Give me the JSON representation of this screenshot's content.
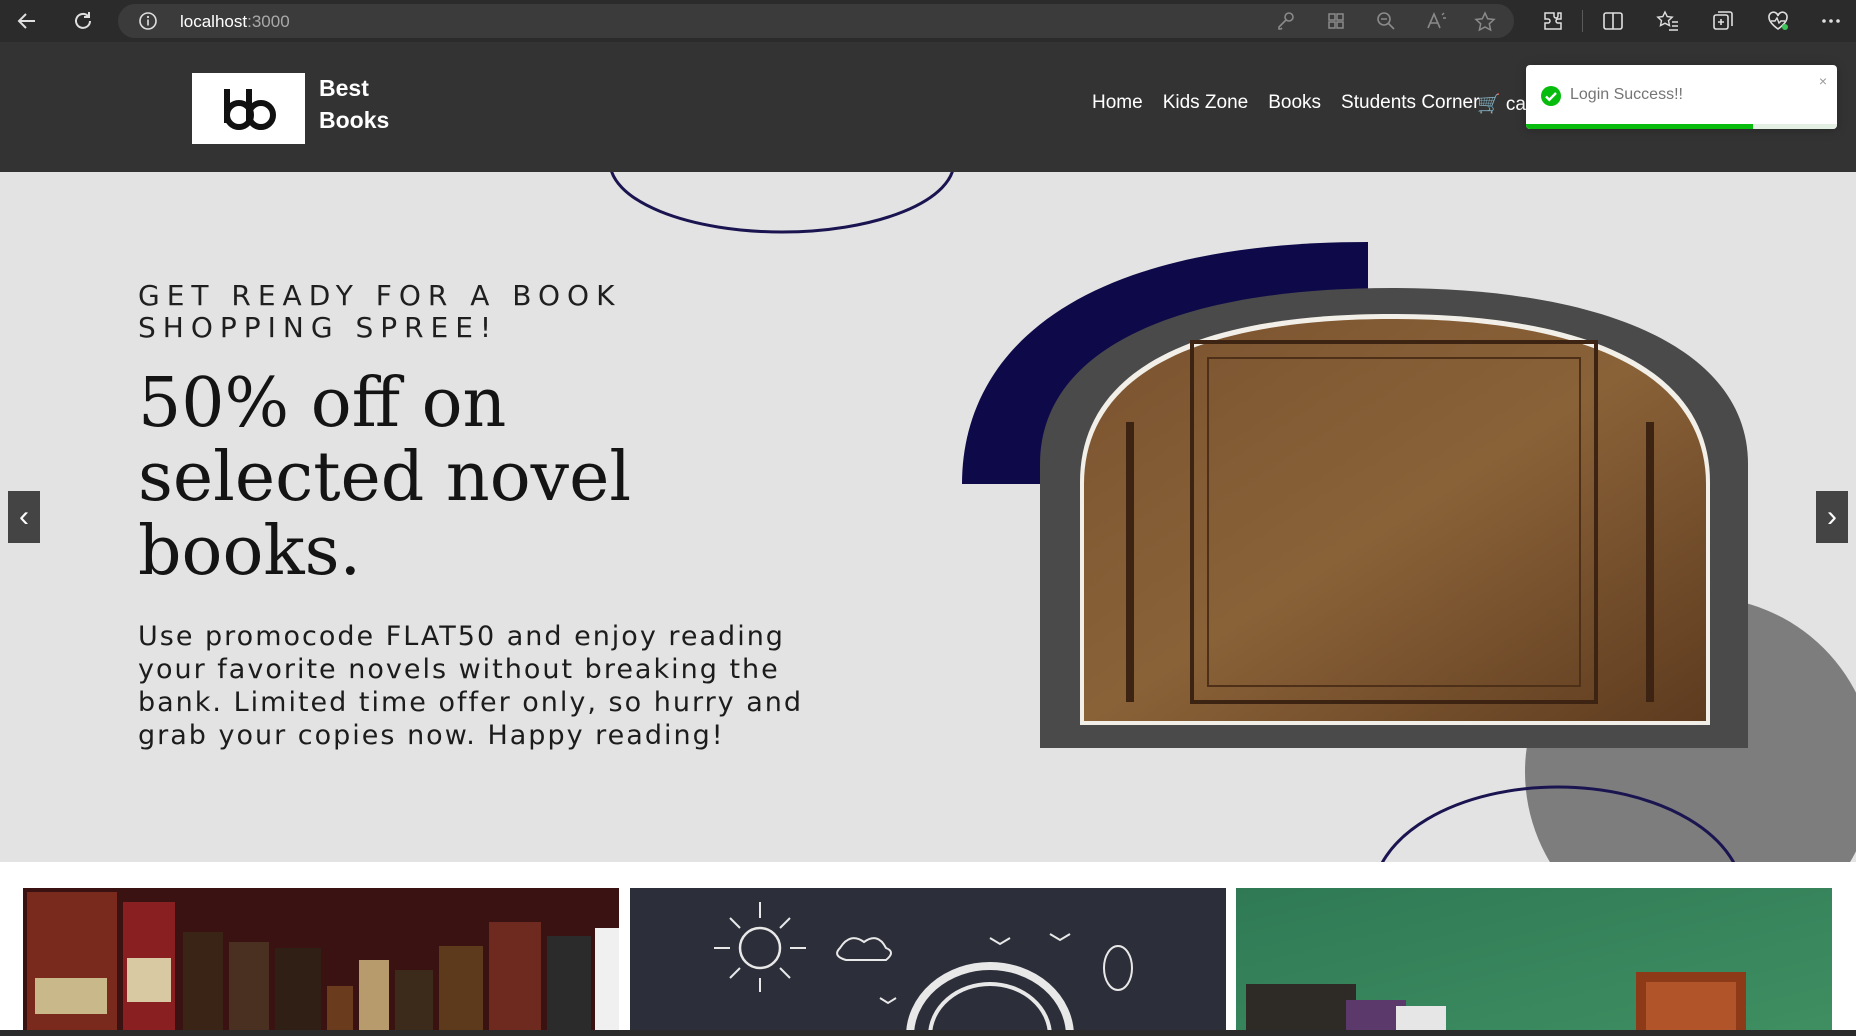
{
  "browser": {
    "url_host": "localhost",
    "url_port": ":3000"
  },
  "site": {
    "brand_line1": "Best",
    "brand_line2": "Books",
    "nav": [
      {
        "label": "Home"
      },
      {
        "label": "Kids Zone"
      },
      {
        "label": "Books"
      },
      {
        "label": "Students Corner"
      }
    ],
    "cart_label": "🛒 car"
  },
  "toast": {
    "message": "Login Success!!",
    "close_glyph": "×",
    "progress": 0.73,
    "color": "#07bc0c"
  },
  "hero": {
    "eyebrow": "GET READY FOR A BOOK SHOPPING SPREE!",
    "title": "50% off on selected novel books.",
    "body": "Use promocode FLAT50 and enjoy reading your favorite novels without breaking the bank. Limited time offer only, so hurry and grab your copies now. Happy reading!",
    "prev_glyph": "‹",
    "next_glyph": "›",
    "accent_color": "#0e0a4a"
  },
  "cards": [
    {
      "theme": "antique-books"
    },
    {
      "theme": "chalk-doodles"
    },
    {
      "theme": "books-green-board"
    }
  ]
}
